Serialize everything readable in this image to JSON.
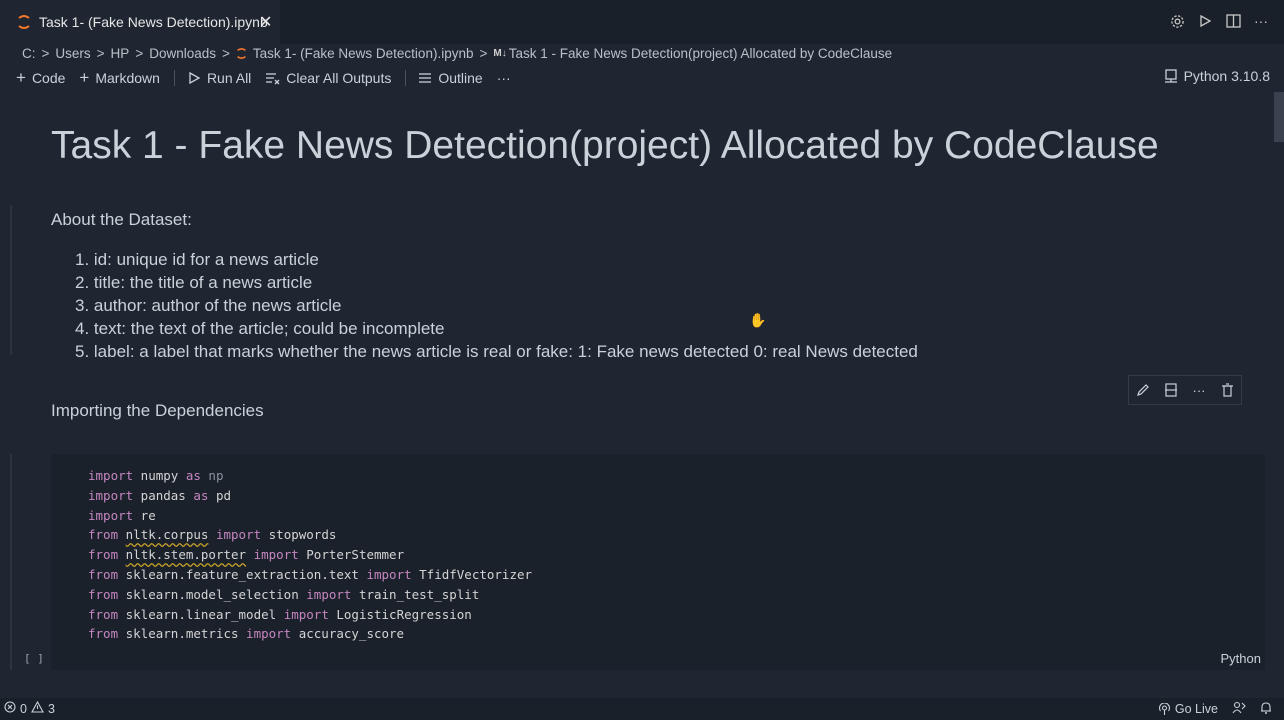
{
  "tab": {
    "title": "Task 1- (Fake News Detection).ipynb",
    "close": "✕"
  },
  "breadcrumb": {
    "items": [
      "C:",
      "Users",
      "HP",
      "Downloads",
      "Task 1- (Fake News Detection).ipynb"
    ],
    "md_tag": "M↓",
    "heading": "Task 1 - Fake News Detection(project) Allocated by CodeClause",
    "sep": ">"
  },
  "toolbar": {
    "code": "Code",
    "markdown": "Markdown",
    "run_all": "Run All",
    "clear_outputs": "Clear All Outputs",
    "outline": "Outline",
    "more": "···"
  },
  "kernel": {
    "label": "Python 3.10.8"
  },
  "notebook": {
    "title": "Task 1 - Fake News Detection(project) Allocated by CodeClause",
    "about": "About the Dataset:",
    "list": [
      "1. id: unique id for a news article",
      "2. title: the title of a news article",
      "3. author: author of the news article",
      "4. text: the text of the article; could be incomplete",
      "5. label: a label that marks whether the news article is real or fake: 1: Fake news detected 0: real News detected"
    ],
    "importing": "Importing the Dependencies",
    "code_lines": [
      [
        "import",
        " numpy ",
        "as",
        " np"
      ],
      [
        "import",
        " pandas ",
        "as",
        " pd"
      ],
      [
        "import",
        " re"
      ],
      [
        "from",
        " ",
        "nltk.corpus",
        " ",
        "import",
        " stopwords"
      ],
      [
        "from",
        " ",
        "nltk.stem.porter",
        " ",
        "import",
        " PorterStemmer"
      ],
      [
        "from",
        " sklearn.feature_extraction.text ",
        "import",
        " TfidfVectorizer"
      ],
      [
        "from",
        " sklearn.model_selection ",
        "import",
        " train_test_split"
      ],
      [
        "from",
        " sklearn.linear_model ",
        "import",
        " LogisticRegression"
      ],
      [
        "from",
        " sklearn.metrics ",
        "import",
        " accuracy_score"
      ]
    ],
    "exec_count": "[ ]",
    "language": "Python"
  },
  "status": {
    "errors": "0",
    "warnings": "3",
    "go_live": "Go Live"
  }
}
